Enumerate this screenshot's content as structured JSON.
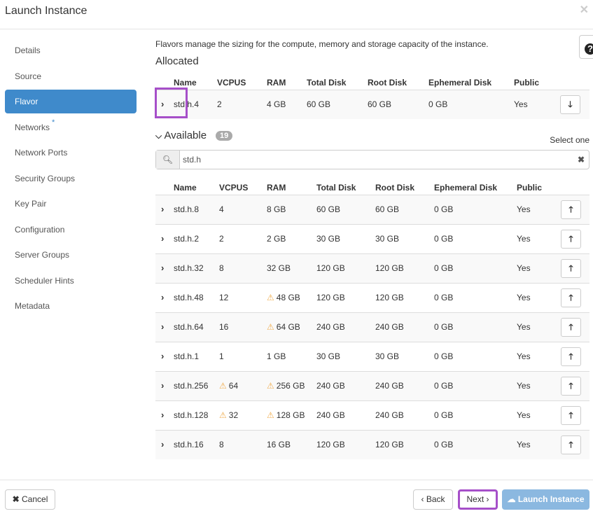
{
  "title": "Launch Instance",
  "sidebar": [
    {
      "label": "Details"
    },
    {
      "label": "Source"
    },
    {
      "label": "Flavor",
      "active": true
    },
    {
      "label": "Networks",
      "required": "*"
    },
    {
      "label": "Network Ports"
    },
    {
      "label": "Security Groups"
    },
    {
      "label": "Key Pair"
    },
    {
      "label": "Configuration"
    },
    {
      "label": "Server Groups"
    },
    {
      "label": "Scheduler Hints"
    },
    {
      "label": "Metadata"
    }
  ],
  "description": "Flavors manage the sizing for the compute, memory and storage capacity of the instance.",
  "allocated": {
    "heading": "Allocated",
    "columns": [
      "Name",
      "VCPUS",
      "RAM",
      "Total Disk",
      "Root Disk",
      "Ephemeral Disk",
      "Public"
    ],
    "rows": [
      {
        "name": "std.h.4",
        "vcpus": "2",
        "ram": "4 GB",
        "total": "60 GB",
        "root": "60 GB",
        "eph": "0 GB",
        "public": "Yes"
      }
    ]
  },
  "available": {
    "heading": "Available",
    "count": "19",
    "select_hint": "Select one",
    "search_value": "std.h",
    "columns": [
      "Name",
      "VCPUS",
      "RAM",
      "Total Disk",
      "Root Disk",
      "Ephemeral Disk",
      "Public"
    ],
    "rows": [
      {
        "name": "std.h.8",
        "vcpus": "4",
        "ram": "8 GB",
        "total": "60 GB",
        "root": "60 GB",
        "eph": "0 GB",
        "public": "Yes"
      },
      {
        "name": "std.h.2",
        "vcpus": "2",
        "ram": "2 GB",
        "total": "30 GB",
        "root": "30 GB",
        "eph": "0 GB",
        "public": "Yes"
      },
      {
        "name": "std.h.32",
        "vcpus": "8",
        "ram": "32 GB",
        "total": "120 GB",
        "root": "120 GB",
        "eph": "0 GB",
        "public": "Yes"
      },
      {
        "name": "std.h.48",
        "vcpus": "12",
        "ram": "48 GB",
        "ram_warn": true,
        "total": "120 GB",
        "root": "120 GB",
        "eph": "0 GB",
        "public": "Yes"
      },
      {
        "name": "std.h.64",
        "vcpus": "16",
        "ram": "64 GB",
        "ram_warn": true,
        "total": "240 GB",
        "root": "240 GB",
        "eph": "0 GB",
        "public": "Yes"
      },
      {
        "name": "std.h.1",
        "vcpus": "1",
        "ram": "1 GB",
        "total": "30 GB",
        "root": "30 GB",
        "eph": "0 GB",
        "public": "Yes"
      },
      {
        "name": "std.h.256",
        "vcpus": "64",
        "vcpus_warn": true,
        "ram": "256 GB",
        "ram_warn": true,
        "total": "240 GB",
        "root": "240 GB",
        "eph": "0 GB",
        "public": "Yes"
      },
      {
        "name": "std.h.128",
        "vcpus": "32",
        "vcpus_warn": true,
        "ram": "128 GB",
        "ram_warn": true,
        "total": "240 GB",
        "root": "240 GB",
        "eph": "0 GB",
        "public": "Yes"
      },
      {
        "name": "std.h.16",
        "vcpus": "8",
        "ram": "16 GB",
        "total": "120 GB",
        "root": "120 GB",
        "eph": "0 GB",
        "public": "Yes"
      }
    ]
  },
  "footer": {
    "cancel": "Cancel",
    "back": "Back",
    "next": "Next",
    "launch": "Launch Instance"
  },
  "colors": {
    "accent": "#3f8acb",
    "highlight": "#a64fc9",
    "warning": "#f0ad4e",
    "launch_disabled": "#8bb8e0"
  }
}
